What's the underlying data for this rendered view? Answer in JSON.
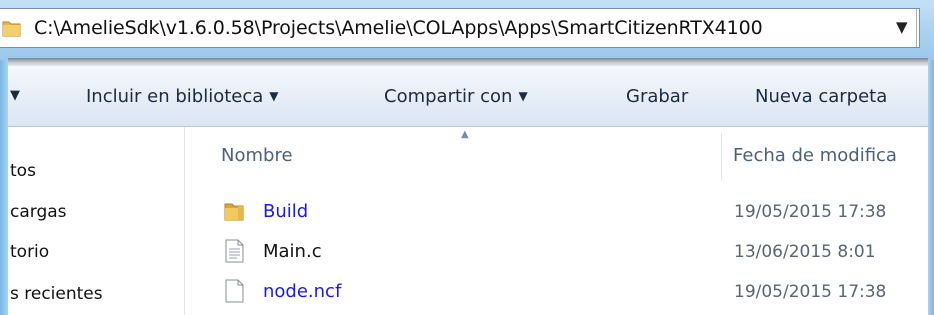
{
  "address_bar": {
    "path": "C:\\AmelieSdk\\v1.6.0.58\\Projects\\Amelie\\COLApps\\Apps\\SmartCitizenRTX4100",
    "dropdown_icon": "chevron-down-icon"
  },
  "toolbar": {
    "partial_caret": "▼",
    "items": [
      {
        "label": "Incluir en biblioteca",
        "caret": "▼"
      },
      {
        "label": "Compartir con",
        "caret": "▼"
      },
      {
        "label": "Grabar"
      },
      {
        "label": "Nueva carpeta"
      }
    ]
  },
  "nav_pane": {
    "items": [
      "tos",
      "cargas",
      "torio",
      "s recientes"
    ]
  },
  "file_list": {
    "columns": {
      "name": "Nombre",
      "date": "Fecha de modifica"
    },
    "rows": [
      {
        "name": "Build",
        "date": "19/05/2015 17:38",
        "icon": "folder-icon"
      },
      {
        "name": "Main.c",
        "date": "13/06/2015 8:01",
        "icon": "text-file-icon"
      },
      {
        "name": "node.ncf",
        "date": "19/05/2015 17:38",
        "icon": "file-icon"
      }
    ]
  },
  "colors": {
    "link_blue": "#1a1ae6",
    "frame_blue": "#8fc3ea",
    "folder_yellow": "#e8b84a"
  }
}
